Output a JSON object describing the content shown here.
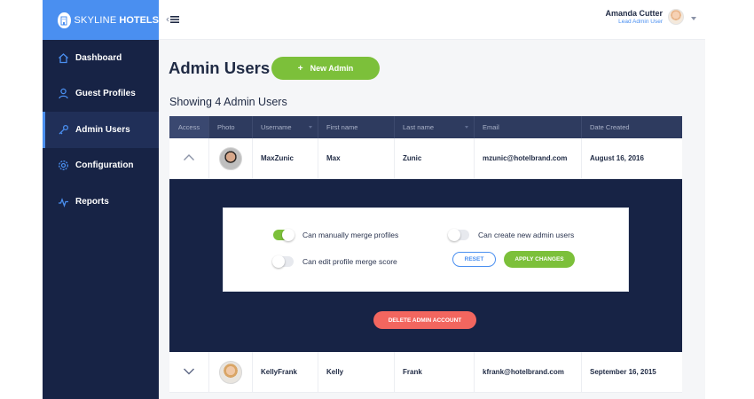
{
  "brand": {
    "light": "SKYLINE",
    "bold": "HOTELS"
  },
  "sidebar": {
    "items": [
      {
        "label": "Dashboard",
        "icon": "home-icon"
      },
      {
        "label": "Guest Profiles",
        "icon": "user-icon"
      },
      {
        "label": "Admin Users",
        "icon": "key-icon",
        "active": true
      },
      {
        "label": "Configuration",
        "icon": "gear-icon"
      },
      {
        "label": "Reports",
        "icon": "activity-icon"
      }
    ]
  },
  "user": {
    "name": "Amanda Cutter",
    "role": "Lead Admin User"
  },
  "page": {
    "title": "Admin Users",
    "new_button": "New Admin",
    "showing": "Showing 4 Admin Users"
  },
  "table": {
    "headers": [
      "Access",
      "Photo",
      "Username",
      "First name",
      "Last name",
      "Email",
      "Date Created"
    ],
    "rows": [
      {
        "username": "MaxZunic",
        "first": "Max",
        "last": "Zunic",
        "email": "mzunic@hotelbrand.com",
        "date": "August 16, 2016",
        "expanded": true
      },
      {
        "username": "KellyFrank",
        "first": "Kelly",
        "last": "Frank",
        "email": "kfrank@hotelbrand.com",
        "date": "September 16, 2015",
        "expanded": false
      }
    ]
  },
  "permissions": {
    "merge": {
      "label": "Can manually merge profiles",
      "on": true
    },
    "edit_score": {
      "label": "Can edit profile merge score",
      "on": false
    },
    "create_admin": {
      "label": "Can create new admin users",
      "on": false
    },
    "reset_label": "RESET",
    "apply_label": "APPLY CHANGES",
    "delete_label": "DELETE ADMIN ACCOUNT"
  },
  "colors": {
    "accent": "#4a8ff0",
    "sidebar": "#172345",
    "success": "#7cc03a",
    "danger": "#f2665f"
  }
}
